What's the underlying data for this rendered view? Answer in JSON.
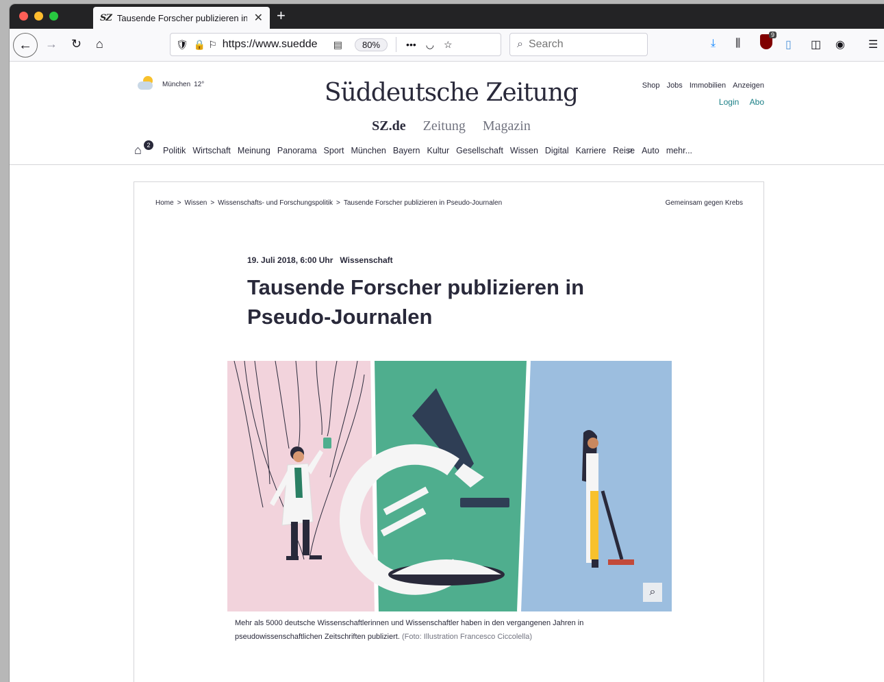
{
  "browser": {
    "tab_title": "Tausende Forscher publizieren in Pseudo-Journalen",
    "tab_favicon": "SZ",
    "url": "https://www.sueddeutsche.de",
    "url_shown": "https://www.suedde",
    "zoom": "80%",
    "search_placeholder": "Search",
    "ublock_count": "9"
  },
  "header": {
    "weather_city": "München",
    "weather_temp": "12°",
    "logo": "Süddeutsche Zeitung",
    "subnav": [
      "SZ.de",
      "Zeitung",
      "Magazin"
    ],
    "toplinks": [
      "Shop",
      "Jobs",
      "Immobilien",
      "Anzeigen"
    ],
    "login": "Login",
    "abo": "Abo",
    "home_badge": "2",
    "ressorts": [
      "Politik",
      "Wirtschaft",
      "Meinung",
      "Panorama",
      "Sport",
      "München",
      "Bayern",
      "Kultur",
      "Gesellschaft",
      "Wissen",
      "Digital",
      "Karriere",
      "Reise",
      "Auto",
      "mehr..."
    ]
  },
  "article": {
    "breadcrumb": [
      "Home",
      "Wissen",
      "Wissenschafts- und Forschungspolitik",
      "Tausende Forscher publizieren in Pseudo-Journalen"
    ],
    "breadcrumb_sep": ">",
    "kampagne": "Gemeinsam gegen Krebs",
    "date": "19. Juli 2018, 6:00 Uhr",
    "rubrik": "Wissenschaft",
    "headline": "Tausende Forscher publizieren in Pseudo-Journalen",
    "caption": "Mehr als 5000 deutsche Wissenschaftlerinnen und Wissenschaftler haben in den vergangenen Jahren in pseudowissenschaftlichen Zeitschriften publiziert.",
    "credit": "(Foto: Illustration Francesco Ciccolella)"
  },
  "colors": {
    "accent_teal": "#1a7f86",
    "illu_pink": "#f2d3dc",
    "illu_green": "#4fae8e",
    "illu_blue": "#9cbedf"
  }
}
